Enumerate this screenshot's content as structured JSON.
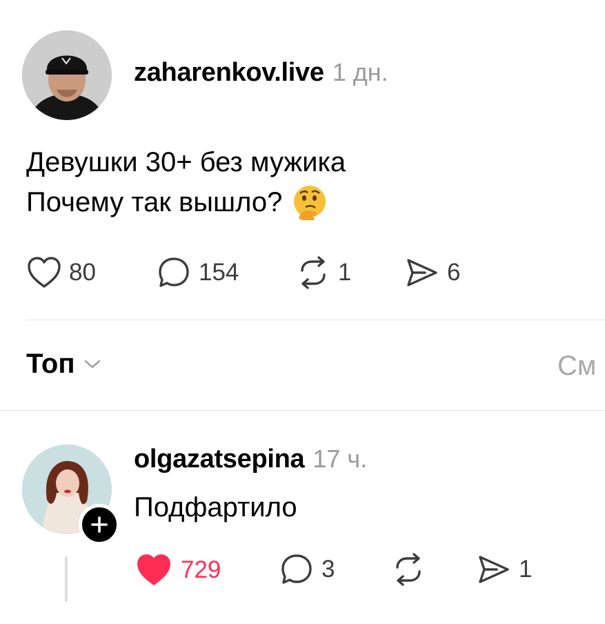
{
  "post": {
    "username": "zaharenkov.live",
    "time": "1 дн.",
    "text_line1": "Девушки 30+ без мужика",
    "text_line2": "Почему так вышло?",
    "emoji": "🤔",
    "actions": {
      "likes": "80",
      "comments": "154",
      "reposts": "1",
      "shares": "6"
    }
  },
  "sort": {
    "label": "Топ",
    "right_label": "См"
  },
  "reply": {
    "username": "olgazatsepina",
    "time": "17 ч.",
    "text": "Подфартило",
    "actions": {
      "likes": "729",
      "comments": "3",
      "shares": "1"
    }
  },
  "colors": {
    "like_active": "#ff2d55",
    "muted": "#9a9a9a",
    "icon": "#3c3c3c"
  }
}
